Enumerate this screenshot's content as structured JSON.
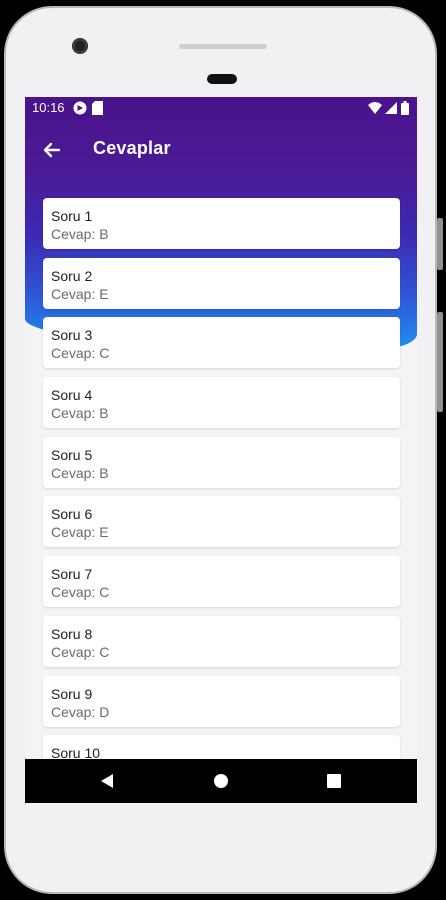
{
  "statusbar": {
    "time": "10:16",
    "icons": [
      "google-play-icon",
      "sim-card-icon",
      "wifi-icon",
      "cellular-signal-icon",
      "battery-icon"
    ]
  },
  "appbar": {
    "back_icon": "arrow-left-icon",
    "title": "Cevaplar"
  },
  "answers": [
    {
      "question": "Soru 1",
      "answer": "Cevap: B"
    },
    {
      "question": "Soru 2",
      "answer": "Cevap: E"
    },
    {
      "question": "Soru 3",
      "answer": "Cevap: C"
    },
    {
      "question": "Soru 4",
      "answer": "Cevap: B"
    },
    {
      "question": "Soru 5",
      "answer": "Cevap: B"
    },
    {
      "question": "Soru 6",
      "answer": "Cevap: E"
    },
    {
      "question": "Soru 7",
      "answer": "Cevap: C"
    },
    {
      "question": "Soru 8",
      "answer": "Cevap: C"
    },
    {
      "question": "Soru 9",
      "answer": "Cevap: D"
    },
    {
      "question": "Soru 10",
      "answer": ""
    }
  ],
  "navbar": {
    "icons": [
      "nav-back-icon",
      "nav-home-icon",
      "nav-recents-icon"
    ]
  },
  "colors": {
    "primary": "#4a148c",
    "gradient_end": "#1e8ff0",
    "card": "#ffffff"
  }
}
